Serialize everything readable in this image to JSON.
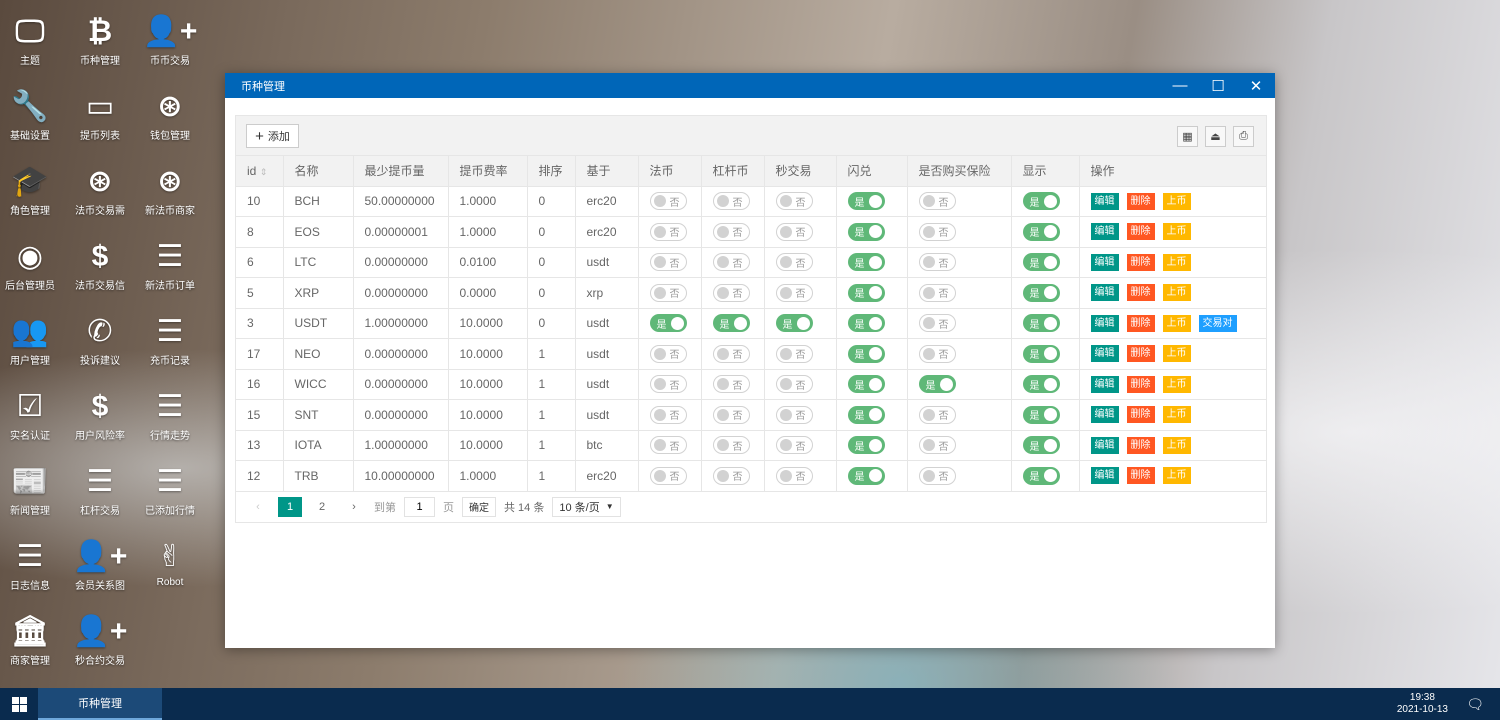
{
  "desktop": [
    {
      "label": "主题",
      "icon": "monitor-icon",
      "g": "🖵"
    },
    {
      "label": "币种管理",
      "icon": "bitcoin-icon",
      "g": "₿"
    },
    {
      "label": "币币交易",
      "icon": "user-plus-icon",
      "g": "👤+"
    },
    {
      "label": "基础设置",
      "icon": "wrench-icon",
      "g": "🔧"
    },
    {
      "label": "提币列表",
      "icon": "credit-card-icon",
      "g": "▭"
    },
    {
      "label": "钱包管理",
      "icon": "link-icon",
      "g": "⊛"
    },
    {
      "label": "角色管理",
      "icon": "graduation-cap-icon",
      "g": "🎓"
    },
    {
      "label": "法币交易需",
      "icon": "link-icon",
      "g": "⊛"
    },
    {
      "label": "新法币商家",
      "icon": "link-icon",
      "g": "⊛"
    },
    {
      "label": "后台管理员",
      "icon": "user-circle-icon",
      "g": "◉"
    },
    {
      "label": "法币交易信",
      "icon": "dollar-icon",
      "g": "$"
    },
    {
      "label": "新法币订单",
      "icon": "list-icon",
      "g": "☰"
    },
    {
      "label": "用户管理",
      "icon": "users-icon",
      "g": "👥"
    },
    {
      "label": "投诉建议",
      "icon": "phone-volume-icon",
      "g": "✆"
    },
    {
      "label": "充币记录",
      "icon": "list-icon",
      "g": "☰"
    },
    {
      "label": "实名认证",
      "icon": "check-square-icon",
      "g": "☑"
    },
    {
      "label": "用户风险率",
      "icon": "dollar-icon",
      "g": "$"
    },
    {
      "label": "行情走势",
      "icon": "list-icon",
      "g": "☰"
    },
    {
      "label": "新闻管理",
      "icon": "newspaper-icon",
      "g": "📰"
    },
    {
      "label": "杠杆交易",
      "icon": "list-icon",
      "g": "☰"
    },
    {
      "label": "已添加行情",
      "icon": "list-icon",
      "g": "☰"
    },
    {
      "label": "日志信息",
      "icon": "list-icon",
      "g": "☰"
    },
    {
      "label": "会员关系图",
      "icon": "user-plus-icon",
      "g": "👤+"
    },
    {
      "label": "Robot",
      "icon": "hand-icon",
      "g": "✌"
    },
    {
      "label": "商家管理",
      "icon": "bank-icon",
      "g": "🏛"
    },
    {
      "label": "秒合约交易",
      "icon": "user-plus-icon",
      "g": "👤+"
    }
  ],
  "window": {
    "title": "币种管理"
  },
  "toolbar": {
    "add_label": "添加"
  },
  "columns": [
    "id",
    "名称",
    "最少提币量",
    "提币费率",
    "排序",
    "基于",
    "法币",
    "杠杆币",
    "秒交易",
    "闪兑",
    "是否购买保险",
    "显示",
    "操作"
  ],
  "toggle_labels": {
    "on": "是",
    "off": "否"
  },
  "actions": {
    "edit": "编辑",
    "delete": "删除",
    "list": "上币",
    "pair": "交易对"
  },
  "colors": {
    "edit": "#009688",
    "delete": "#ff5722",
    "list": "#ffb800",
    "pair": "#1e9fff",
    "switch_on": "#5fb878",
    "title_bar": "#0066b8"
  },
  "rows": [
    {
      "id": "10",
      "name": "BCH",
      "min": "50.00000000",
      "fee": "1.0000",
      "sort": "0",
      "base": "erc20",
      "fiat": false,
      "lever": false,
      "second": false,
      "flash": true,
      "insurance": false,
      "show": true,
      "pair": false
    },
    {
      "id": "8",
      "name": "EOS",
      "min": "0.00000001",
      "fee": "1.0000",
      "sort": "0",
      "base": "erc20",
      "fiat": false,
      "lever": false,
      "second": false,
      "flash": true,
      "insurance": false,
      "show": true,
      "pair": false
    },
    {
      "id": "6",
      "name": "LTC",
      "min": "0.00000000",
      "fee": "0.0100",
      "sort": "0",
      "base": "usdt",
      "fiat": false,
      "lever": false,
      "second": false,
      "flash": true,
      "insurance": false,
      "show": true,
      "pair": false
    },
    {
      "id": "5",
      "name": "XRP",
      "min": "0.00000000",
      "fee": "0.0000",
      "sort": "0",
      "base": "xrp",
      "fiat": false,
      "lever": false,
      "second": false,
      "flash": true,
      "insurance": false,
      "show": true,
      "pair": false
    },
    {
      "id": "3",
      "name": "USDT",
      "min": "1.00000000",
      "fee": "10.0000",
      "sort": "0",
      "base": "usdt",
      "fiat": true,
      "lever": true,
      "second": true,
      "flash": true,
      "insurance": false,
      "show": true,
      "pair": true
    },
    {
      "id": "17",
      "name": "NEO",
      "min": "0.00000000",
      "fee": "10.0000",
      "sort": "1",
      "base": "usdt",
      "fiat": false,
      "lever": false,
      "second": false,
      "flash": true,
      "insurance": false,
      "show": true,
      "pair": false
    },
    {
      "id": "16",
      "name": "WICC",
      "min": "0.00000000",
      "fee": "10.0000",
      "sort": "1",
      "base": "usdt",
      "fiat": false,
      "lever": false,
      "second": false,
      "flash": true,
      "insurance": true,
      "show": true,
      "pair": false
    },
    {
      "id": "15",
      "name": "SNT",
      "min": "0.00000000",
      "fee": "10.0000",
      "sort": "1",
      "base": "usdt",
      "fiat": false,
      "lever": false,
      "second": false,
      "flash": true,
      "insurance": false,
      "show": true,
      "pair": false
    },
    {
      "id": "13",
      "name": "IOTA",
      "min": "1.00000000",
      "fee": "10.0000",
      "sort": "1",
      "base": "btc",
      "fiat": false,
      "lever": false,
      "second": false,
      "flash": true,
      "insurance": false,
      "show": true,
      "pair": false
    },
    {
      "id": "12",
      "name": "TRB",
      "min": "10.00000000",
      "fee": "1.0000",
      "sort": "1",
      "base": "erc20",
      "fiat": false,
      "lever": false,
      "second": false,
      "flash": true,
      "insurance": false,
      "show": true,
      "pair": false
    }
  ],
  "pagination": {
    "pages": [
      "1",
      "2"
    ],
    "current": "1",
    "goto_label": "到第",
    "goto_value": "1",
    "page_label": "页",
    "confirm": "确定",
    "total": "共 14 条",
    "page_size": "10 条/页"
  },
  "taskbar": {
    "task": "币种管理",
    "time": "19:38",
    "date": "2021-10-13"
  }
}
